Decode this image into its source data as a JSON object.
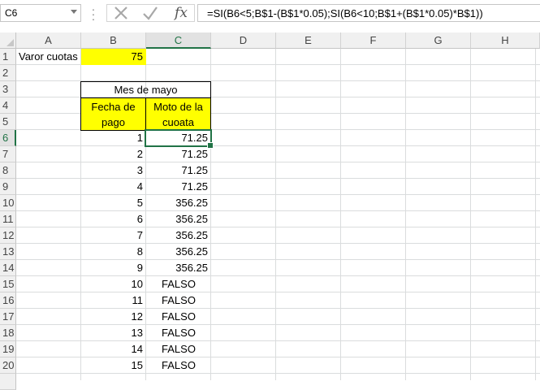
{
  "formula_bar": {
    "name_box": "C6",
    "cancel_icon": "x-icon",
    "enter_icon": "check-icon",
    "fx_label": "fx",
    "formula": "=SI(B6<5;B$1-(B$1*0.05);SI(B6<10;B$1+(B$1*0.05)*B$1))"
  },
  "columns": [
    "A",
    "B",
    "C",
    "D",
    "E",
    "F",
    "G",
    "H"
  ],
  "rows": [
    "1",
    "2",
    "3",
    "4",
    "5",
    "6",
    "7",
    "8",
    "9",
    "10",
    "11",
    "12",
    "13",
    "14",
    "15",
    "16",
    "17",
    "18",
    "19",
    "20"
  ],
  "cells": {
    "A1": "Varor cuotas",
    "B1": "75",
    "B3": "Mes de mayo",
    "B4": "Fecha de pago",
    "C4": "Moto de la cuoata",
    "B4_line1": "Fecha de",
    "B4_line2": "pago",
    "C4_line1": "Moto de la",
    "C4_line2": "cuoata"
  },
  "table": {
    "payment_dates": [
      "1",
      "2",
      "3",
      "4",
      "5",
      "6",
      "7",
      "8",
      "9",
      "10",
      "11",
      "12",
      "13",
      "14",
      "15"
    ],
    "amounts": [
      "71.25",
      "71.25",
      "71.25",
      "71.25",
      "356.25",
      "356.25",
      "356.25",
      "356.25",
      "356.25",
      "FALSO",
      "FALSO",
      "FALSO",
      "FALSO",
      "FALSO",
      "FALSO"
    ]
  },
  "selected_cell": "C6",
  "colors": {
    "highlight": "#ffff00",
    "selection": "#217346",
    "header_bg": "#f0f0f0"
  }
}
